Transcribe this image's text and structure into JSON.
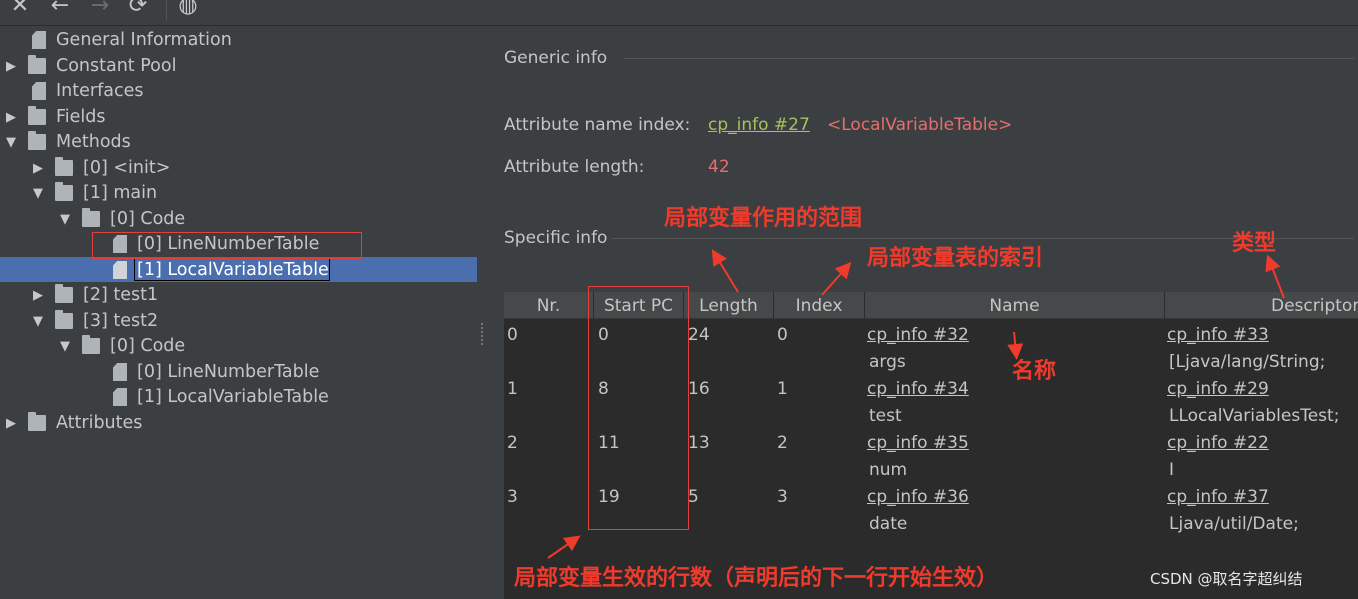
{
  "toolbar": {
    "icons": [
      "close-icon",
      "back-icon",
      "forward-icon",
      "refresh-icon",
      "globe-icon"
    ]
  },
  "tree": {
    "general_information": "General Information",
    "constant_pool": "Constant Pool",
    "interfaces": "Interfaces",
    "fields": "Fields",
    "methods": "Methods",
    "init": "[0] <init>",
    "main": "[1] main",
    "main_code": "[0] Code",
    "main_line_number_table": "[0] LineNumberTable",
    "main_local_variable_table": "[1] LocalVariableTable",
    "test1": "[2] test1",
    "test2": "[3] test2",
    "test2_code": "[0] Code",
    "test2_line_number_table": "[0] LineNumberTable",
    "test2_local_variable_table": "[1] LocalVariableTable",
    "attributes": "Attributes"
  },
  "generic_info": {
    "title": "Generic info",
    "name_index_label": "Attribute name index:",
    "name_index_link": "cp_info #27",
    "name_index_value": "<LocalVariableTable>",
    "length_label": "Attribute length:",
    "length_value": "42"
  },
  "specific_info": {
    "title": "Specific info"
  },
  "table": {
    "columns": [
      "Nr.",
      "Start PC",
      "Length",
      "Index",
      "Name",
      "Descriptor"
    ],
    "rows": [
      {
        "nr": "0",
        "start_pc": "0",
        "length": "24",
        "index": "0",
        "name_link": "cp_info #32",
        "name": "args",
        "desc_link": "cp_info #33",
        "desc": "[Ljava/lang/String;"
      },
      {
        "nr": "1",
        "start_pc": "8",
        "length": "16",
        "index": "1",
        "name_link": "cp_info #34",
        "name": "test",
        "desc_link": "cp_info #29",
        "desc": "LLocalVariablesTest;"
      },
      {
        "nr": "2",
        "start_pc": "11",
        "length": "13",
        "index": "2",
        "name_link": "cp_info #35",
        "name": "num",
        "desc_link": "cp_info #22",
        "desc": "I"
      },
      {
        "nr": "3",
        "start_pc": "19",
        "length": "5",
        "index": "3",
        "name_link": "cp_info #36",
        "name": "date",
        "desc_link": "cp_info #37",
        "desc": "Ljava/util/Date;"
      }
    ]
  },
  "annotations": {
    "scope": "局部变量作用的范围",
    "table_index": "局部变量表的索引",
    "type": "类型",
    "name": "名称",
    "effective_line": "局部变量生效的行数（声明后的下一行开始生效）"
  },
  "watermark": "CSDN @取名字超纠结",
  "colors": {
    "background": "#3c3f41",
    "selection": "#4b6eaf",
    "link": "#a5c25c",
    "annotation_red": "#f03a2c"
  }
}
